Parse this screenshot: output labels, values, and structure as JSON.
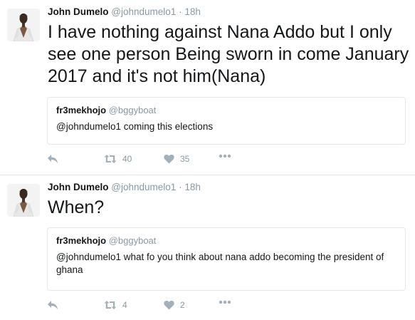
{
  "tweets": [
    {
      "author": {
        "name": "John Dumelo",
        "handle": "@johndumelo1",
        "time": "18h"
      },
      "text": "I have nothing against Nana Addo but I only see one person Being sworn in come January 2017 and it's not him(Nana)",
      "quote": {
        "name": "fr3mekhojo",
        "handle": "@bggyboat",
        "text": "@johndumelo1 coming this elections"
      },
      "retweets": "40",
      "likes": "35"
    },
    {
      "author": {
        "name": "John Dumelo",
        "handle": "@johndumelo1",
        "time": "18h"
      },
      "text": "When?",
      "quote": {
        "name": "fr3mekhojo",
        "handle": "@bggyboat",
        "text": "@johndumelo1 what fo you think about nana addo becoming the president of ghana"
      },
      "retweets": "4",
      "likes": "2"
    }
  ],
  "separator": "·",
  "icons": {
    "reply": "reply-icon",
    "retweet": "retweet-icon",
    "like": "heart-icon",
    "more": "more-icon"
  },
  "colors": {
    "icon": "#a3afb9",
    "meta": "#8899a6",
    "border": "#e1e8ed"
  }
}
